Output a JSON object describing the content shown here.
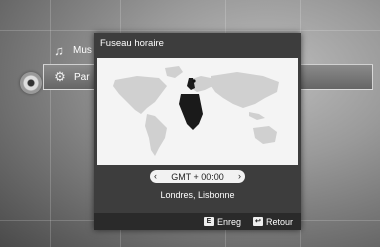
{
  "menu": {
    "items": [
      {
        "label": "Mus",
        "icon": "music-note-icon"
      },
      {
        "label": "Par",
        "icon": "gear-icon"
      }
    ]
  },
  "dialog": {
    "title": "Fuseau horaire",
    "timezone_value": "GMT + 00:00",
    "city": "Londres, Lisbonne",
    "footer": {
      "save_label": "Enreg",
      "back_label": "Retour"
    }
  }
}
